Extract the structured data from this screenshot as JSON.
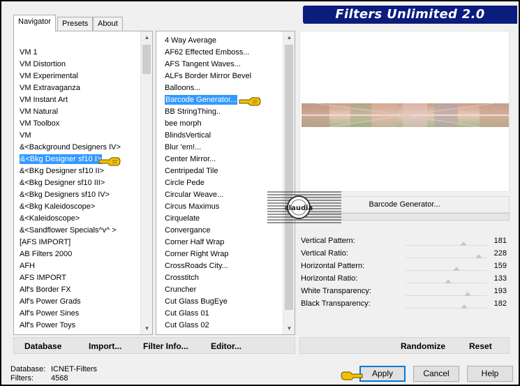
{
  "window": {
    "title": "Filters Unlimited 2.0"
  },
  "tabs": [
    "Navigator",
    "Presets",
    "About"
  ],
  "navigator": {
    "selected": "&<Bkg Designer sf10 I>",
    "items": [
      "VM 1",
      "VM Distortion",
      "VM Experimental",
      "VM Extravaganza",
      "VM Instant Art",
      "VM Natural",
      "VM Toolbox",
      "VM",
      "&<Background Designers IV>",
      "&<Bkg Designer sf10 I>",
      "&<BKg Designer sf10 II>",
      "&<Bkg Designer sf10 III>",
      "&<Bkg Designers sf10 IV>",
      "&<Bkg Kaleidoscope>",
      "&<Kaleidoscope>",
      "&<Sandflower Specials^v^ >",
      "[AFS IMPORT]",
      "AB Filters 2000",
      "AFH",
      "AFS IMPORT",
      "Alf's Border FX",
      "Alf's Power Grads",
      "Alf's Power Sines",
      "Alf's Power Toys"
    ]
  },
  "filters": {
    "selected": "Barcode Generator...",
    "items": [
      "4 Way Average",
      "AF62 Effected Emboss...",
      "AFS Tangent Waves...",
      "ALFs Border Mirror Bevel",
      "Balloons...",
      "Barcode Generator...",
      "BB StringThing..",
      "bee morph",
      "BlindsVertical",
      "Blur 'em!...",
      "Center Mirror...",
      "Centripedal Tile",
      "Circle Pede",
      "Circular Weave...",
      "Circus Maximus",
      "Cirquelate",
      "Convergance",
      "Corner Half Wrap",
      "Corner Right Wrap",
      "CrossRoads City...",
      "Crosstitch",
      "Cruncher",
      "Cut Glass  BugEye",
      "Cut Glass 01",
      "Cut Glass 02"
    ]
  },
  "nav_bar": {
    "database": "Database",
    "import": "Import...",
    "filter_info": "Filter Info...",
    "editor": "Editor..."
  },
  "filter_name": "Barcode Generator...",
  "parameters": [
    {
      "label": "Vertical Pattern:",
      "value": "181",
      "level": 181
    },
    {
      "label": "Vertical Ratio:",
      "value": "228",
      "level": 228
    },
    {
      "label": "Horizontal Pattern:",
      "value": "159",
      "level": 159
    },
    {
      "label": "Horizontal Ratio:",
      "value": "133",
      "level": 133
    },
    {
      "label": "White Transparency:",
      "value": "193",
      "level": 193
    },
    {
      "label": "Black Transparency:",
      "value": "182",
      "level": 182
    }
  ],
  "right_bar": {
    "randomize": "Randomize",
    "reset": "Reset"
  },
  "footer": {
    "database_label": "Database:",
    "database_value": "ICNET-Filters",
    "filters_label": "Filters:",
    "filters_value": "4568"
  },
  "buttons": {
    "apply": "Apply",
    "cancel": "Cancel",
    "help": "Help"
  },
  "watermark": {
    "text": "claudia"
  },
  "colors": {
    "banner": "#0a1c7e",
    "selection": "#3399ff",
    "hand": "#f2c200"
  }
}
